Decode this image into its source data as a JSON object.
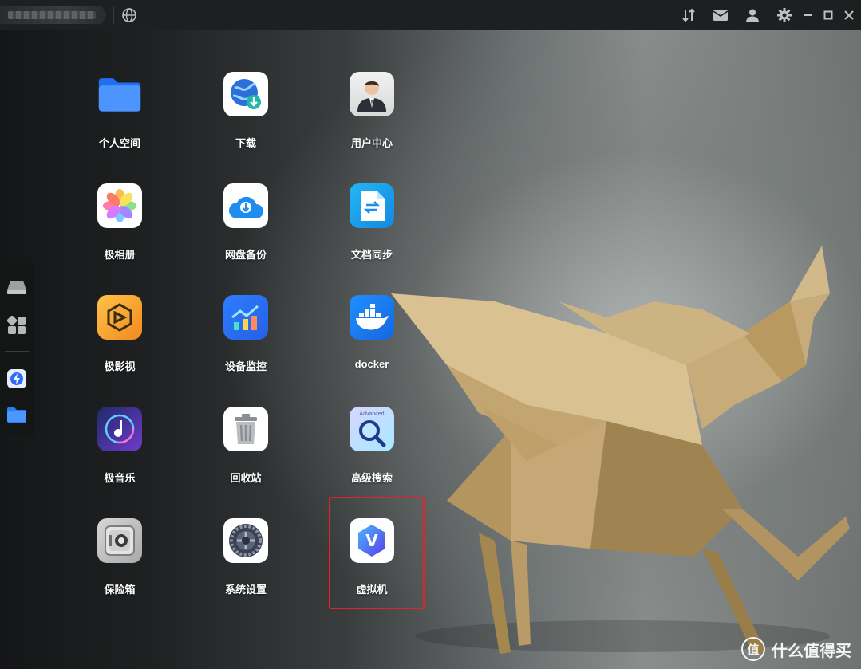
{
  "topbar": {
    "window_controls": [
      "transfer-icon",
      "mail-icon",
      "user-icon",
      "gear-icon",
      "minimize-icon",
      "maximize-icon",
      "close-icon"
    ]
  },
  "dock": {
    "items": [
      "drive-icon",
      "apps-grid-icon",
      "speed-app-icon",
      "folder-icon"
    ]
  },
  "apps": [
    {
      "label": "个人空间",
      "icon": "folder-icon"
    },
    {
      "label": "下载",
      "icon": "download-globe-icon"
    },
    {
      "label": "用户中心",
      "icon": "user-center-icon"
    },
    {
      "label": "极相册",
      "icon": "photos-icon"
    },
    {
      "label": "网盘备份",
      "icon": "cloud-backup-icon"
    },
    {
      "label": "文档同步",
      "icon": "doc-sync-icon"
    },
    {
      "label": "极影视",
      "icon": "video-icon"
    },
    {
      "label": "设备监控",
      "icon": "monitor-chart-icon"
    },
    {
      "label": "docker",
      "icon": "docker-icon"
    },
    {
      "label": "极音乐",
      "icon": "music-icon"
    },
    {
      "label": "回收站",
      "icon": "trash-icon"
    },
    {
      "label": "高级搜索",
      "icon": "advanced-search-icon",
      "badge": "Advanced"
    },
    {
      "label": "保险箱",
      "icon": "safe-icon"
    },
    {
      "label": "系统设置",
      "icon": "system-settings-icon"
    },
    {
      "label": "虚拟机",
      "icon": "virtual-machine-icon",
      "badge": "V"
    }
  ],
  "highlight_color": "#e0242a",
  "watermark": {
    "badge": "值",
    "text": "什么值得买"
  }
}
